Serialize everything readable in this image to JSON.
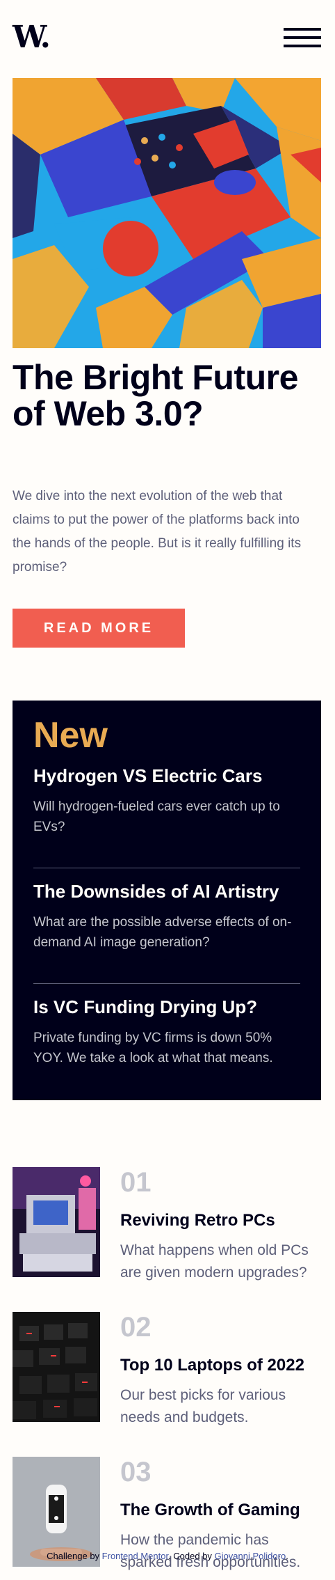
{
  "header": {
    "logo_letter": "W",
    "logo_dot": ".",
    "menu_icon": "hamburger-menu-icon"
  },
  "hero": {
    "image_alt": "abstract colorful 3D blocks",
    "title": "The Bright Future of Web 3.0?",
    "description": "We dive into the next evolution of the web that claims to put the power of the platforms back into the hands of the people. But is it really fulfilling its promise?",
    "button_label": "Read more"
  },
  "new_section": {
    "title": "New",
    "items": [
      {
        "title": "Hydrogen VS Electric Cars",
        "description": "Will hydrogen-fueled cars ever catch up to EVs?"
      },
      {
        "title": "The Downsides of AI Artistry",
        "description": "What are the possible adverse effects of on-demand AI image generation?"
      },
      {
        "title": "Is VC Funding Drying Up?",
        "description": "Private funding by VC firms is down 50% YOY. We take a look at what that means."
      }
    ]
  },
  "ranked": [
    {
      "number": "01",
      "title": "Reviving Retro PCs",
      "description": "What happens when old PCs are given modern upgrades?"
    },
    {
      "number": "02",
      "title": "Top 10 Laptops of 2022",
      "description": "Our best picks for various needs and budgets."
    },
    {
      "number": "03",
      "title": "The Growth of Gaming",
      "description": "How the pandemic has sparked fresh opportunities."
    }
  ],
  "footer": {
    "prefix": "Challenge by ",
    "link1": "Frontend Mentor",
    "middle": ". Coded by ",
    "link2": "Giovanni Polidoro",
    "suffix": "."
  },
  "colors": {
    "background": "#fffdfa",
    "dark": "#00001a",
    "accent_red": "#f15e50",
    "accent_orange": "#e9ab53",
    "grayish_blue": "#5d5f79",
    "gray": "#c5c6ce"
  }
}
